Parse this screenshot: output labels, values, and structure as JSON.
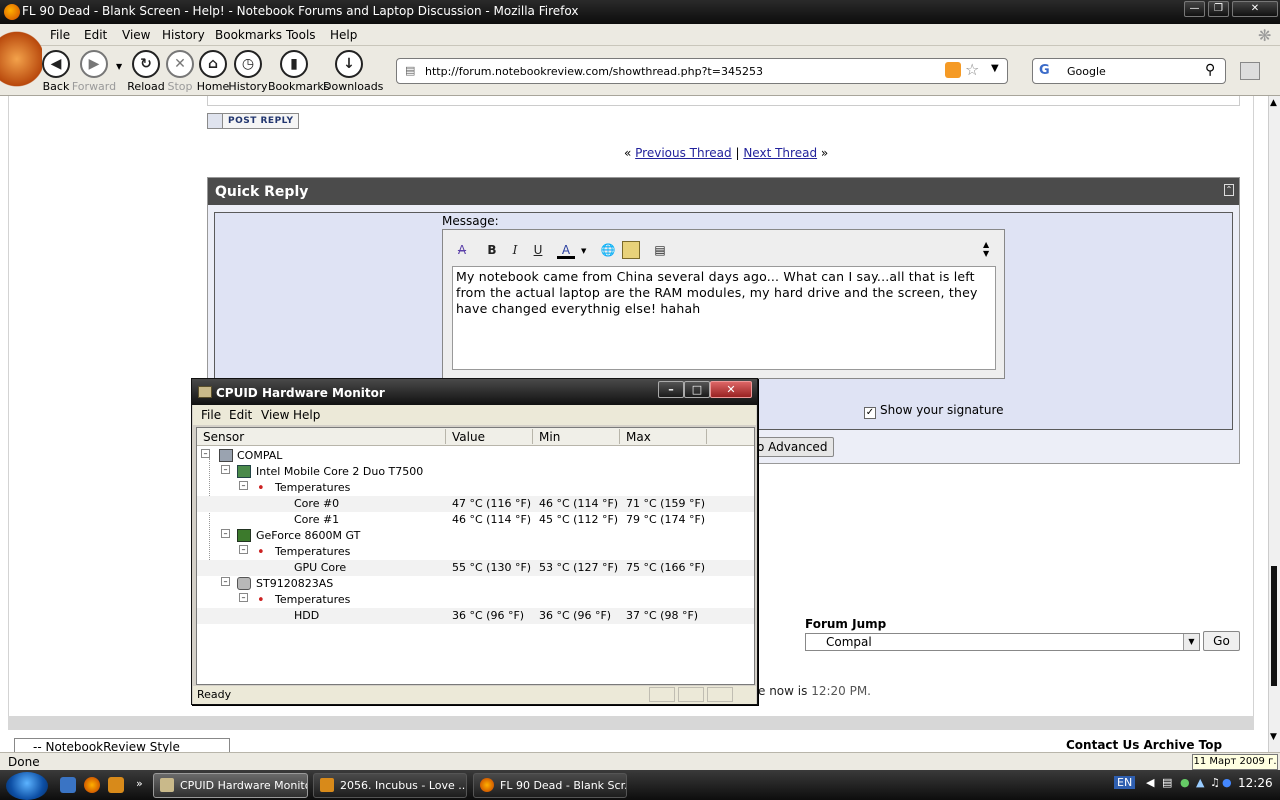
{
  "browser": {
    "title": "FL 90 Dead - Blank Screen - Help! - Notebook Forums and Laptop Discussion - Mozilla Firefox",
    "menu": [
      "File",
      "Edit",
      "View",
      "History",
      "Bookmarks",
      "Tools",
      "Help"
    ],
    "toolbar": {
      "back": "Back",
      "forward": "Forward",
      "reload": "Reload",
      "stop": "Stop",
      "home": "Home",
      "history": "History",
      "bookmarks": "Bookmarks",
      "downloads": "Downloads"
    },
    "url": "http://forum.notebookreview.com/showthread.php?t=345253",
    "search_engine": "Google",
    "status": "Done"
  },
  "page": {
    "post_reply": "POST REPLY",
    "prev_thread": "Previous Thread",
    "next_thread": "Next Thread",
    "quick_reply": {
      "title": "Quick Reply",
      "message_label": "Message:",
      "message": "My notebook came from China several days ago... What can I say...all that is left from the actual laptop are the RAM modules, my hard drive and the screen, they have changed everythnig else! hahah",
      "show_signature": "Show your signature",
      "advanced_button": "o Advanced"
    },
    "forum_jump": {
      "label": "Forum Jump",
      "selected": "Compal",
      "go": "Go"
    },
    "time_prefix": "e now is",
    "time": "12:20 PM.",
    "style_select": "-- NotebookReview Style",
    "footer_links": "Contact Us    Archive    Top"
  },
  "cpuid": {
    "title": "CPUID Hardware Monitor",
    "menu": [
      "File",
      "Edit",
      "View",
      "Help"
    ],
    "columns": [
      "Sensor",
      "Value",
      "Min",
      "Max"
    ],
    "status": "Ready",
    "tree": {
      "root": "COMPAL",
      "cpu": "Intel Mobile Core 2 Duo T7500",
      "gpu": "GeForce 8600M GT",
      "hdd": "ST9120823AS",
      "temps": "Temperatures",
      "rows": [
        {
          "name": "Core #0",
          "value": "47 °C  (116 °F)",
          "min": "46 °C  (114 °F)",
          "max": "71 °C  (159 °F)"
        },
        {
          "name": "Core #1",
          "value": "46 °C  (114 °F)",
          "min": "45 °C  (112 °F)",
          "max": "79 °C  (174 °F)"
        },
        {
          "name": "GPU Core",
          "value": "55 °C  (130 °F)",
          "min": "53 °C  (127 °F)",
          "max": "75 °C  (166 °F)"
        },
        {
          "name": "HDD",
          "value": "36 °C  (96 °F)",
          "min": "36 °C  (96 °F)",
          "max": "37 °C  (98 °F)"
        }
      ]
    }
  },
  "taskbar": {
    "tasks": [
      "CPUID Hardware Monitor",
      "2056. Incubus - Love ...",
      "FL 90 Dead - Blank Scr..."
    ],
    "lang": "EN",
    "clock": "12:26",
    "date_tip": "11 Март 2009 г."
  }
}
